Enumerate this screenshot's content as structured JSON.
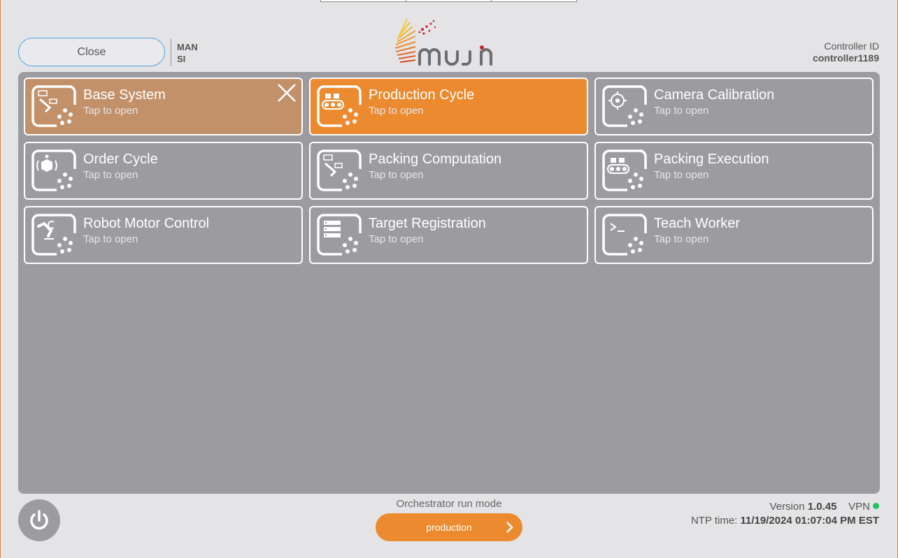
{
  "header": {
    "close_label": "Close",
    "mode_line1": "MAN",
    "mode_line2": "SI",
    "controller_label": "Controller ID",
    "controller_id": "controller1189"
  },
  "tiles": [
    {
      "title": "Base System",
      "subtitle": "Tap to open",
      "icon": "robot-flow-icon",
      "state": "selected"
    },
    {
      "title": "Production Cycle",
      "subtitle": "Tap to open",
      "icon": "conveyor-icon",
      "state": "active"
    },
    {
      "title": "Camera Calibration",
      "subtitle": "Tap to open",
      "icon": "crosshair-icon",
      "state": "normal"
    },
    {
      "title": "Order Cycle",
      "subtitle": "Tap to open",
      "icon": "box-cycle-icon",
      "state": "normal"
    },
    {
      "title": "Packing Computation",
      "subtitle": "Tap to open",
      "icon": "robot-flow-icon",
      "state": "normal"
    },
    {
      "title": "Packing Execution",
      "subtitle": "Tap to open",
      "icon": "conveyor-icon",
      "state": "normal"
    },
    {
      "title": "Robot Motor Control",
      "subtitle": "Tap to open",
      "icon": "robot-arm-icon",
      "state": "normal"
    },
    {
      "title": "Target Registration",
      "subtitle": "Tap to open",
      "icon": "list-icon",
      "state": "normal"
    },
    {
      "title": "Teach Worker",
      "subtitle": "Tap to open",
      "icon": "terminal-icon",
      "state": "normal"
    }
  ],
  "footer": {
    "runmode_label": "Orchestrator run mode",
    "runmode_value": "production",
    "version_label": "Version",
    "version_value": "1.0.45",
    "vpn_label": "VPN",
    "vpn_status_color": "#22c55e",
    "ntp_label": "NTP time:",
    "ntp_value": "11/19/2024 01:07:04 PM EST"
  },
  "colors": {
    "accent": "#ec8a2f",
    "selected_tile": "#c2916a",
    "panel": "#9c9ba0"
  }
}
